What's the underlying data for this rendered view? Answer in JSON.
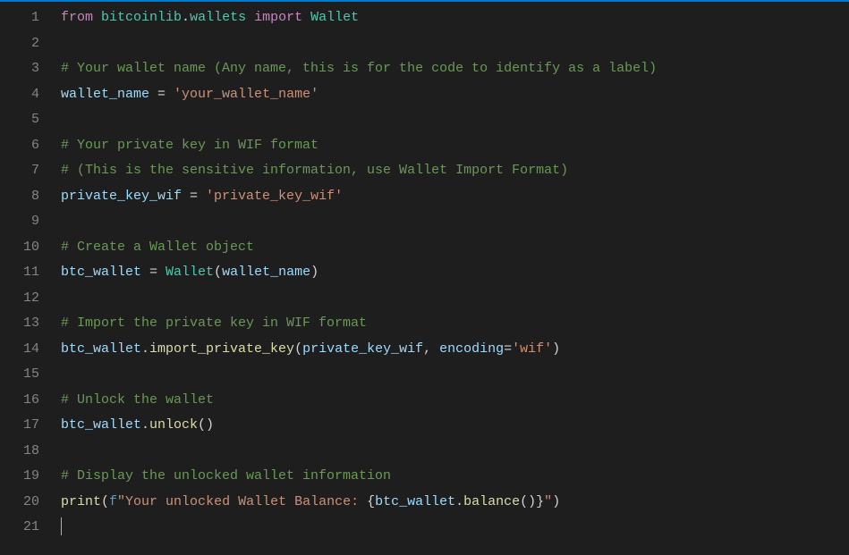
{
  "editor": {
    "lines": [
      {
        "n": 1,
        "tokens": [
          [
            "kw",
            "from"
          ],
          [
            "op",
            " "
          ],
          [
            "mod",
            "bitcoinlib"
          ],
          [
            "op",
            "."
          ],
          [
            "mod",
            "wallets"
          ],
          [
            "op",
            " "
          ],
          [
            "kw",
            "import"
          ],
          [
            "op",
            " "
          ],
          [
            "mod",
            "Wallet"
          ]
        ]
      },
      {
        "n": 2,
        "tokens": []
      },
      {
        "n": 3,
        "tokens": [
          [
            "cmt",
            "# Your wallet name (Any name, this is for the code to identify as a label)"
          ]
        ]
      },
      {
        "n": 4,
        "tokens": [
          [
            "var",
            "wallet_name"
          ],
          [
            "op",
            " = "
          ],
          [
            "str",
            "'your_wallet_name'"
          ]
        ]
      },
      {
        "n": 5,
        "tokens": []
      },
      {
        "n": 6,
        "tokens": [
          [
            "cmt",
            "# Your private key in WIF format"
          ]
        ]
      },
      {
        "n": 7,
        "tokens": [
          [
            "cmt",
            "# (This is the sensitive information, use Wallet Import Format)"
          ]
        ]
      },
      {
        "n": 8,
        "tokens": [
          [
            "var",
            "private_key_wif"
          ],
          [
            "op",
            " = "
          ],
          [
            "str",
            "'private_key_wif'"
          ]
        ]
      },
      {
        "n": 9,
        "tokens": []
      },
      {
        "n": 10,
        "tokens": [
          [
            "cmt",
            "# Create a Wallet object"
          ]
        ]
      },
      {
        "n": 11,
        "tokens": [
          [
            "var",
            "btc_wallet"
          ],
          [
            "op",
            " = "
          ],
          [
            "mod",
            "Wallet"
          ],
          [
            "op",
            "("
          ],
          [
            "var",
            "wallet_name"
          ],
          [
            "op",
            ")"
          ]
        ]
      },
      {
        "n": 12,
        "tokens": []
      },
      {
        "n": 13,
        "tokens": [
          [
            "cmt",
            "# Import the private key in WIF format"
          ]
        ]
      },
      {
        "n": 14,
        "tokens": [
          [
            "var",
            "btc_wallet"
          ],
          [
            "op",
            "."
          ],
          [
            "fn",
            "import_private_key"
          ],
          [
            "op",
            "("
          ],
          [
            "var",
            "private_key_wif"
          ],
          [
            "op",
            ", "
          ],
          [
            "var",
            "encoding"
          ],
          [
            "op",
            "="
          ],
          [
            "str",
            "'wif'"
          ],
          [
            "op",
            ")"
          ]
        ]
      },
      {
        "n": 15,
        "tokens": []
      },
      {
        "n": 16,
        "tokens": [
          [
            "cmt",
            "# Unlock the wallet"
          ]
        ]
      },
      {
        "n": 17,
        "tokens": [
          [
            "var",
            "btc_wallet"
          ],
          [
            "op",
            "."
          ],
          [
            "fn",
            "unlock"
          ],
          [
            "op",
            "()"
          ]
        ]
      },
      {
        "n": 18,
        "tokens": []
      },
      {
        "n": 19,
        "tokens": [
          [
            "cmt",
            "# Display the unlocked wallet information"
          ]
        ]
      },
      {
        "n": 20,
        "tokens": [
          [
            "fn",
            "print"
          ],
          [
            "op",
            "("
          ],
          [
            "blue",
            "f"
          ],
          [
            "str",
            "\"Your unlocked Wallet Balance: "
          ],
          [
            "op",
            "{"
          ],
          [
            "var",
            "btc_wallet"
          ],
          [
            "op",
            "."
          ],
          [
            "fn",
            "balance"
          ],
          [
            "op",
            "()}"
          ],
          [
            "str",
            "\""
          ],
          [
            "op",
            ")"
          ]
        ]
      },
      {
        "n": 21,
        "tokens": [],
        "cursor": true
      }
    ]
  }
}
